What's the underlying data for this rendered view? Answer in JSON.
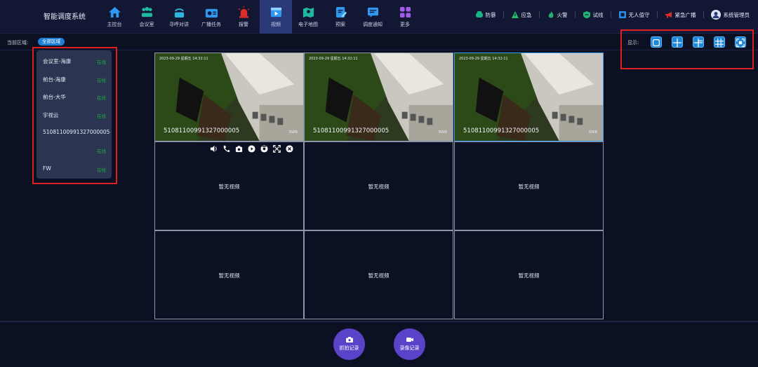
{
  "header": {
    "title": "智能调度系统",
    "nav": [
      {
        "label": "主控台",
        "icon": "home-icon"
      },
      {
        "label": "会议室",
        "icon": "meeting-icon"
      },
      {
        "label": "寻呼对讲",
        "icon": "intercom-icon"
      },
      {
        "label": "广播任务",
        "icon": "broadcast-icon"
      },
      {
        "label": "报警",
        "icon": "alarm-icon"
      },
      {
        "label": "视频",
        "icon": "video-icon",
        "active": true
      },
      {
        "label": "电子地图",
        "icon": "map-icon"
      },
      {
        "label": "预案",
        "icon": "plan-icon"
      },
      {
        "label": "调度通知",
        "icon": "notice-icon"
      },
      {
        "label": "更多",
        "icon": "more-icon"
      }
    ],
    "quick": [
      {
        "label": "防暴",
        "icon": "riot-icon",
        "color": "#1ab38a"
      },
      {
        "label": "应急",
        "icon": "emergency-icon",
        "color": "#1fbf6a"
      },
      {
        "label": "火警",
        "icon": "fire-icon",
        "color": "#24b070"
      },
      {
        "label": "试线",
        "icon": "line-test-icon",
        "color": "#22b577"
      },
      {
        "label": "无人值守",
        "icon": "unattended-icon",
        "color": "#2d8de6"
      },
      {
        "label": "紧急广播",
        "icon": "megaphone-icon",
        "color": "#e02b2b"
      }
    ],
    "user": "系统管理员"
  },
  "subbar": {
    "area_label": "当前区域:",
    "area_chip": "全部区域",
    "layout_label": "显示:"
  },
  "devices": [
    {
      "name": "会议室-海康",
      "status": "在线"
    },
    {
      "name": "前台-海康",
      "status": "在线"
    },
    {
      "name": "前台-大华",
      "status": "在线"
    },
    {
      "name": "宇视云",
      "status": "在线"
    },
    {
      "name": "51081100991327000005",
      "status": ""
    },
    {
      "name": "",
      "status": "在线"
    },
    {
      "name": "FW",
      "status": "在线"
    }
  ],
  "videos": [
    {
      "timestamp": "2023-09-29 星期五 14:32:11",
      "device_id": "51081100991327000005",
      "tag": "SW6"
    },
    {
      "timestamp": "2023-09-29 星期五 14:32:11",
      "device_id": "51081100991327000005",
      "tag": "SW6"
    },
    {
      "timestamp": "2023-09-29 星期五 14:32:11",
      "device_id": "51081100991327000005",
      "tag": "SW6"
    }
  ],
  "empty_text": "暂无视频",
  "bottom": {
    "snapshot": "抓拍记录",
    "recording": "录像记录"
  }
}
